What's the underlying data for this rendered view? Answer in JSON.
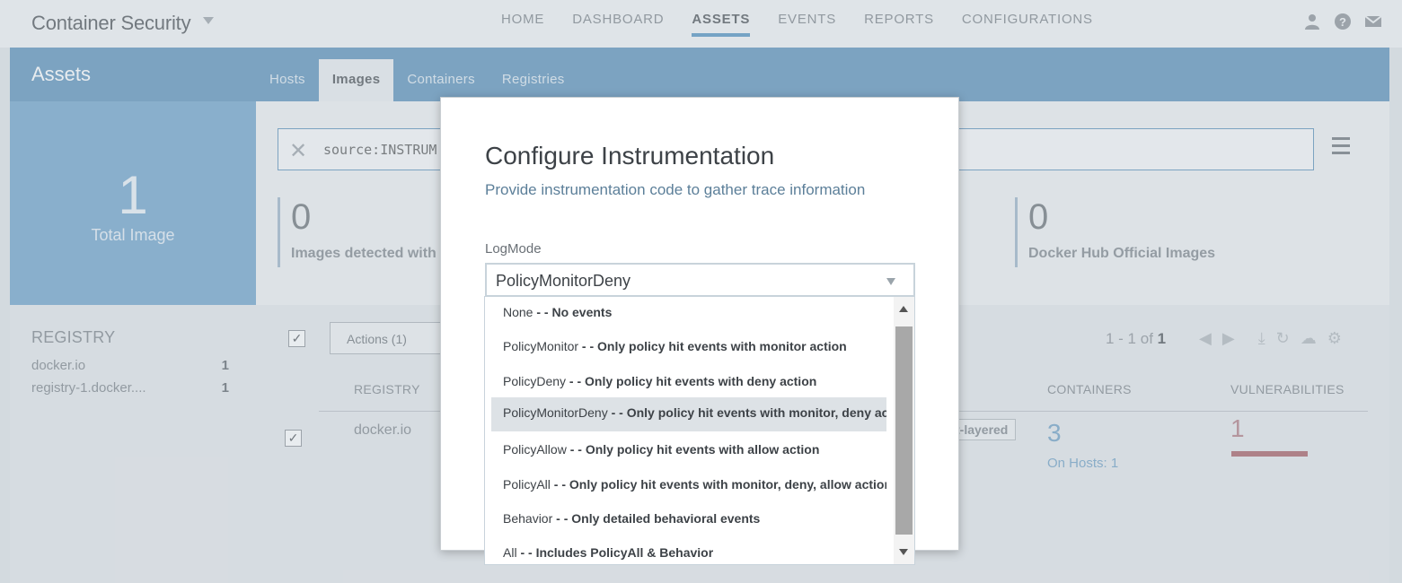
{
  "app": {
    "title": "Container Security"
  },
  "nav": {
    "items": [
      {
        "label": "HOME"
      },
      {
        "label": "DASHBOARD"
      },
      {
        "label": "ASSETS"
      },
      {
        "label": "EVENTS"
      },
      {
        "label": "REPORTS"
      },
      {
        "label": "CONFIGURATIONS"
      }
    ],
    "active": "ASSETS"
  },
  "top_icons": [
    "user-icon",
    "help-icon",
    "mail-icon"
  ],
  "page": {
    "title": "Assets",
    "tabs": [
      {
        "label": "Hosts"
      },
      {
        "label": "Images"
      },
      {
        "label": "Containers"
      },
      {
        "label": "Registries"
      }
    ],
    "active_tab": "Images"
  },
  "summary": {
    "total_value": "1",
    "total_label": "Total Image"
  },
  "registry": {
    "heading": "REGISTRY",
    "items": [
      {
        "name": "docker.io",
        "count": "1"
      },
      {
        "name": "registry-1.docker....",
        "count": "1"
      }
    ]
  },
  "search": {
    "value": "source:INSTRUM"
  },
  "stats": [
    {
      "value": "0",
      "label": "Images detected with"
    },
    {
      "value": "0",
      "label": "Docker Hub Official Images"
    }
  ],
  "table": {
    "actions_label": "Actions (1)",
    "pager": {
      "range": "1 - 1 of",
      "total": "1"
    },
    "columns": {
      "registry": "REGISTRY",
      "containers": "CONTAINERS",
      "vulnerabilities": "VULNERABILITIES"
    },
    "row": {
      "registry": "docker.io",
      "tag": "t-layered",
      "containers": "3",
      "on_hosts": "On Hosts: 1",
      "vulnerabilities": "1"
    }
  },
  "modal": {
    "title": "Configure Instrumentation",
    "subtitle": "Provide instrumentation code to gather trace information",
    "field_label": "LogMode",
    "selected": "PolicyMonitorDeny",
    "options": [
      {
        "name": "None",
        "sep": " - - ",
        "desc": "No events"
      },
      {
        "name": "PolicyMonitor",
        "sep": " - - ",
        "desc": "Only policy hit events with monitor action"
      },
      {
        "name": "PolicyDeny",
        "sep": " - - ",
        "desc": "Only policy hit events with deny action"
      },
      {
        "name": "PolicyMonitorDeny",
        "sep": " - - ",
        "desc": "Only policy hit events with monitor, deny ac"
      },
      {
        "name": "PolicyAllow",
        "sep": " - - ",
        "desc": "Only policy hit events with allow action"
      },
      {
        "name": "PolicyAll",
        "sep": " - - ",
        "desc": "Only policy hit events with monitor, deny, allow action"
      },
      {
        "name": "Behavior",
        "sep": " - - ",
        "desc": "Only detailed behavioral events"
      },
      {
        "name": "All",
        "sep": " - - ",
        "desc": "Includes PolicyAll & Behavior"
      }
    ]
  }
}
